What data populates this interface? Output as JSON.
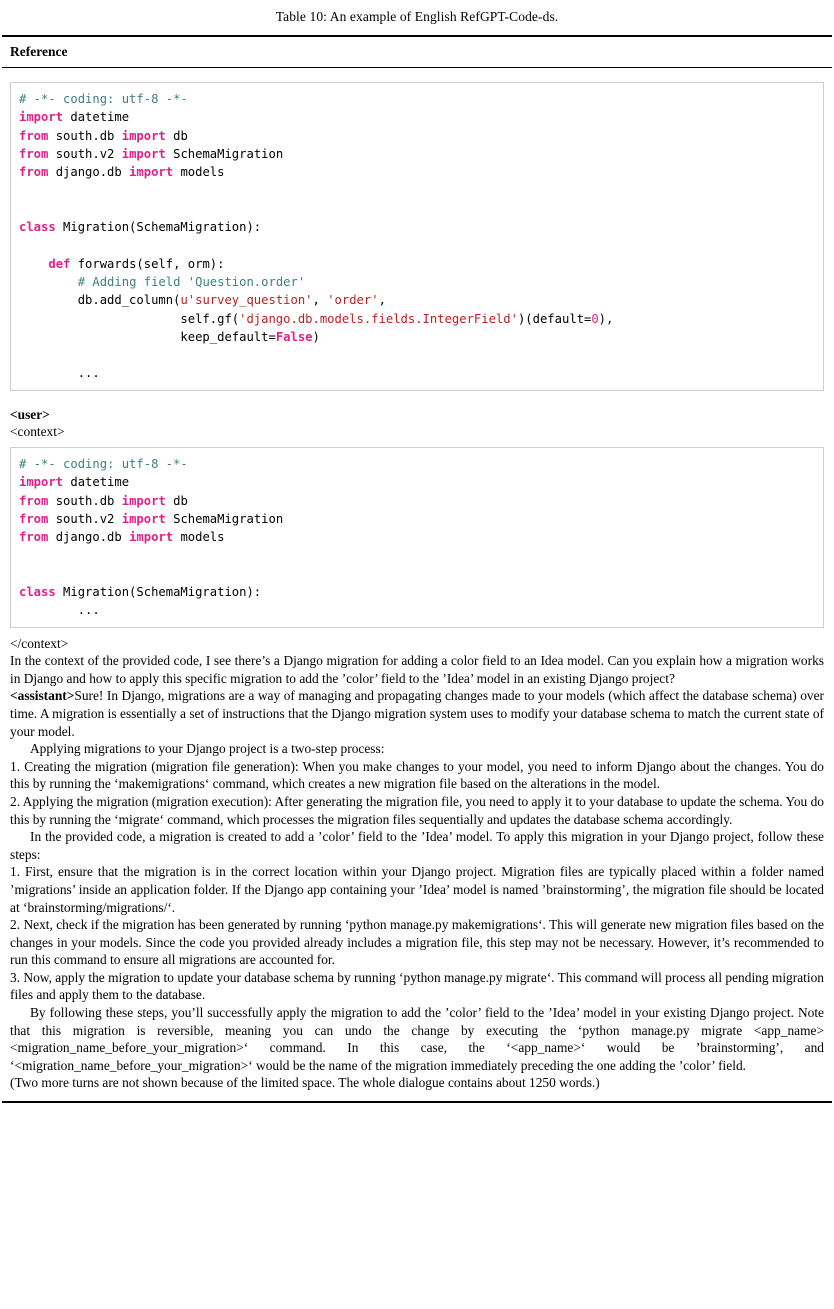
{
  "caption": "Table 10: An example of English RefGPT-Code-ds.",
  "table": {
    "header": "Reference",
    "reference_code": {
      "lines": [
        [
          {
            "t": "c",
            "v": "# -*- coding: utf-8 -*-"
          }
        ],
        [
          {
            "t": "k",
            "v": "import"
          },
          {
            "t": "n",
            "v": " datetime"
          }
        ],
        [
          {
            "t": "k",
            "v": "from"
          },
          {
            "t": "n",
            "v": " south.db "
          },
          {
            "t": "k",
            "v": "import"
          },
          {
            "t": "n",
            "v": " db"
          }
        ],
        [
          {
            "t": "k",
            "v": "from"
          },
          {
            "t": "n",
            "v": " south.v2 "
          },
          {
            "t": "k",
            "v": "import"
          },
          {
            "t": "n",
            "v": " SchemaMigration"
          }
        ],
        [
          {
            "t": "k",
            "v": "from"
          },
          {
            "t": "n",
            "v": " django.db "
          },
          {
            "t": "k",
            "v": "import"
          },
          {
            "t": "n",
            "v": " models"
          }
        ],
        [
          {
            "t": "n",
            "v": ""
          }
        ],
        [
          {
            "t": "n",
            "v": ""
          }
        ],
        [
          {
            "t": "k",
            "v": "class"
          },
          {
            "t": "n",
            "v": " Migration(SchemaMigration):"
          }
        ],
        [
          {
            "t": "n",
            "v": ""
          }
        ],
        [
          {
            "t": "n",
            "v": "    "
          },
          {
            "t": "k",
            "v": "def"
          },
          {
            "t": "n",
            "v": " forwards(self, orm):"
          }
        ],
        [
          {
            "t": "n",
            "v": "        "
          },
          {
            "t": "c",
            "v": "# Adding field 'Question.order'"
          }
        ],
        [
          {
            "t": "n",
            "v": "        db.add_column("
          },
          {
            "t": "s",
            "v": "u'survey_question'"
          },
          {
            "t": "n",
            "v": ", "
          },
          {
            "t": "s",
            "v": "'order'"
          },
          {
            "t": "n",
            "v": ","
          }
        ],
        [
          {
            "t": "n",
            "v": "                      self.gf("
          },
          {
            "t": "s",
            "v": "'django.db.models.fields.IntegerField'"
          },
          {
            "t": "n",
            "v": ")(default="
          },
          {
            "t": "mi",
            "v": "0"
          },
          {
            "t": "n",
            "v": "),"
          }
        ],
        [
          {
            "t": "n",
            "v": "                      keep_default="
          },
          {
            "t": "kc",
            "v": "False"
          },
          {
            "t": "n",
            "v": ")"
          }
        ],
        [
          {
            "t": "n",
            "v": ""
          }
        ],
        [
          {
            "t": "n",
            "v": "        ..."
          }
        ]
      ]
    },
    "user_tag": "<user>",
    "context_open_tag": "<context>",
    "context_code": {
      "lines": [
        [
          {
            "t": "c",
            "v": "# -*- coding: utf-8 -*-"
          }
        ],
        [
          {
            "t": "k",
            "v": "import"
          },
          {
            "t": "n",
            "v": " datetime"
          }
        ],
        [
          {
            "t": "k",
            "v": "from"
          },
          {
            "t": "n",
            "v": " south.db "
          },
          {
            "t": "k",
            "v": "import"
          },
          {
            "t": "n",
            "v": " db"
          }
        ],
        [
          {
            "t": "k",
            "v": "from"
          },
          {
            "t": "n",
            "v": " south.v2 "
          },
          {
            "t": "k",
            "v": "import"
          },
          {
            "t": "n",
            "v": " SchemaMigration"
          }
        ],
        [
          {
            "t": "k",
            "v": "from"
          },
          {
            "t": "n",
            "v": " django.db "
          },
          {
            "t": "k",
            "v": "import"
          },
          {
            "t": "n",
            "v": " models"
          }
        ],
        [
          {
            "t": "n",
            "v": ""
          }
        ],
        [
          {
            "t": "n",
            "v": ""
          }
        ],
        [
          {
            "t": "k",
            "v": "class"
          },
          {
            "t": "n",
            "v": " Migration(SchemaMigration):"
          }
        ],
        [
          {
            "t": "n",
            "v": "        ..."
          }
        ]
      ]
    },
    "context_close_tag": "</context>",
    "user_question": "In the context of the provided code, I see there’s a Django migration for adding a color field to an Idea model. Can you explain how a migration works in Django and how to apply this specific migration to add the ’color’ field to the ’Idea’ model in an existing Django project?",
    "assistant_tag": "<assistant>",
    "assistant_paragraphs": [
      {
        "indent": false,
        "text": "Sure! In Django, migrations are a way of managing and propagating changes made to your models (which affect the database schema) over time. A migration is essentially a set of instructions that the Django migration system uses to modify your database schema to match the current state of your model."
      },
      {
        "indent": true,
        "text": "Applying migrations to your Django project is a two-step process:"
      },
      {
        "indent": false,
        "text": "1. Creating the migration (migration file generation): When you make changes to your model, you need to inform Django about the changes. You do this by running the ‘makemigrations‘ command, which creates a new migration file based on the alterations in the model."
      },
      {
        "indent": false,
        "text": "2. Applying the migration (migration execution): After generating the migration file, you need to apply it to your database to update the schema. You do this by running the ‘migrate‘ command, which processes the migration files sequentially and updates the database schema accordingly."
      },
      {
        "indent": true,
        "text": "In the provided code, a migration is created to add a ’color’ field to the ’Idea’ model. To apply this migration in your Django project, follow these steps:"
      },
      {
        "indent": false,
        "text": "1. First, ensure that the migration is in the correct location within your Django project. Migration files are typically placed within a folder named ’migrations’ inside an application folder. If the Django app containing your ’Idea’ model is named ’brainstorming’, the migration file should be located at ‘brainstorming/migrations/‘."
      },
      {
        "indent": false,
        "text": "2. Next, check if the migration has been generated by running ‘python manage.py makemigrations‘. This will generate new migration files based on the changes in your models. Since the code you provided already includes a migration file, this step may not be necessary. However, it’s recommended to run this command to ensure all migrations are accounted for."
      },
      {
        "indent": false,
        "text": "3. Now, apply the migration to update your database schema by running ‘python manage.py migrate‘. This command will process all pending migration files and apply them to the database."
      },
      {
        "indent": true,
        "text": "By following these steps, you’ll successfully apply the migration to add the ’color’ field to the ’Idea’ model in your existing Django project. Note that this migration is reversible, meaning you can undo the change by executing the ‘python manage.py migrate <app_name> <migration_name_before_your_migration>‘ command. In this case, the ‘<app_name>‘ would be ’brainstorming’, and ‘<migration_name_before_your_migration>‘ would be the name of the migration immediately preceding the one adding the ’color’ field."
      }
    ],
    "footnote": "(Two more turns are not shown because of the limited space. The whole dialogue contains about 1250 words.)"
  },
  "colors": {
    "comment": "#408080",
    "keyword": "#e0218a",
    "string": "#ba2121",
    "plain": "#000000",
    "code_border": "#cfcfcf",
    "rule": "#000000"
  }
}
